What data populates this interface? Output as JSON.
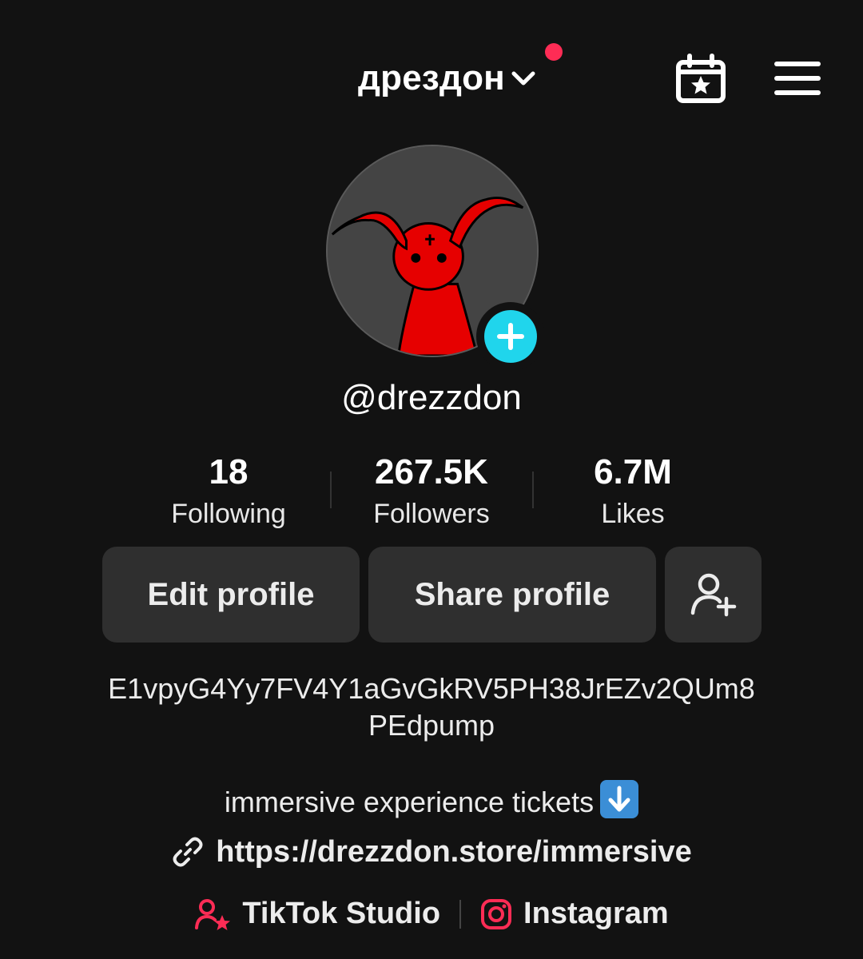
{
  "header": {
    "title": "дрездон"
  },
  "profile": {
    "username": "@drezzdon"
  },
  "stats": [
    {
      "value": "18",
      "label": "Following"
    },
    {
      "value": "267.5K",
      "label": "Followers"
    },
    {
      "value": "6.7M",
      "label": "Likes"
    }
  ],
  "actions": {
    "edit_label": "Edit profile",
    "share_label": "Share profile"
  },
  "bio": {
    "line1": "E1vpyG4Yy7FV4Y1aGvGkRV5PH38JrEZv2QUm8",
    "line2": "PEdpump",
    "line3": "immersive experience tickets",
    "link": "https://drezzdon.store/immersive"
  },
  "social": {
    "studio_label": "TikTok Studio",
    "instagram_label": "Instagram"
  },
  "colors": {
    "background": "#121212",
    "accent_red": "#fe2c55",
    "add_button": "#20d5ec",
    "button_bg": "#2f2f2f"
  },
  "icons": {
    "calendar": "calendar-star-icon",
    "menu": "hamburger-menu-icon",
    "add_friend": "add-friend-icon",
    "link": "link-icon",
    "studio": "tiktok-studio-icon",
    "instagram": "instagram-icon"
  }
}
